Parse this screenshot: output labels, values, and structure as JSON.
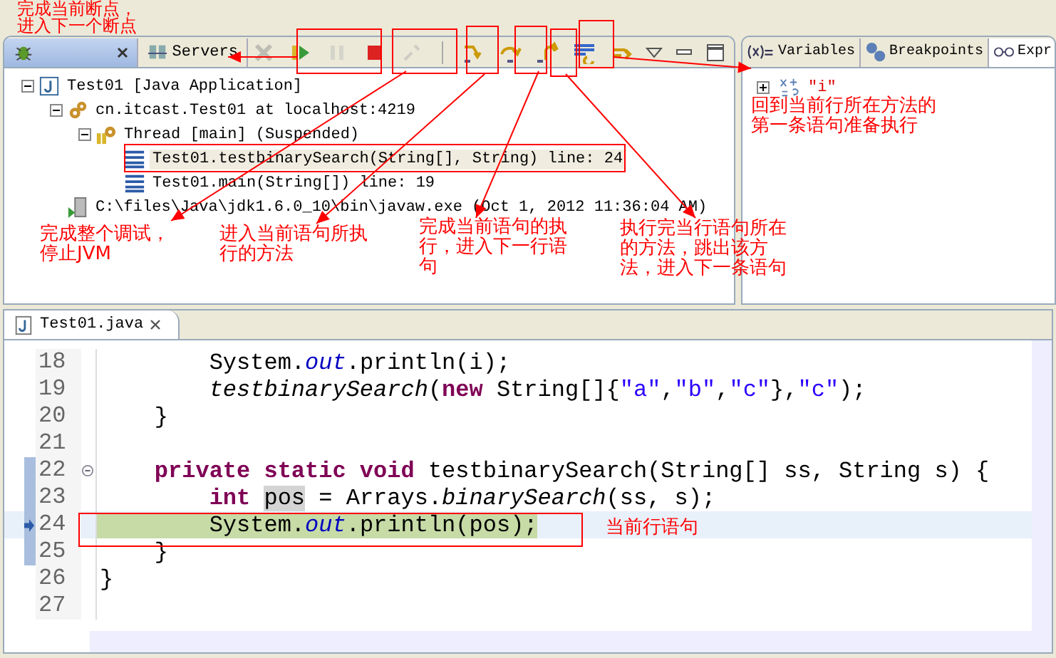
{
  "debug_view": {
    "tabs": [
      {
        "kind": "debug",
        "selected": true
      },
      {
        "kind": "servers",
        "label": "Servers",
        "selected": false
      }
    ],
    "toolbar": [
      {
        "kind": "skip",
        "disabled": true
      },
      {
        "kind": "resume",
        "disabled": false
      },
      {
        "kind": "suspend",
        "disabled": true
      },
      {
        "kind": "terminate",
        "disabled": false
      },
      {
        "kind": "disconnect",
        "disabled": true
      },
      {
        "kind": "step-into",
        "disabled": false
      },
      {
        "kind": "step-over",
        "disabled": false
      },
      {
        "kind": "step-return",
        "disabled": false
      },
      {
        "kind": "drop-to-frame",
        "disabled": false
      },
      {
        "kind": "step-filters",
        "disabled": false
      }
    ],
    "tree": [
      {
        "kind": "launch",
        "label": "Test01 [Java Application]",
        "expanded": true,
        "selected": false,
        "children": [
          {
            "kind": "target",
            "label": "cn.itcast.Test01 at localhost:4219",
            "expanded": true,
            "selected": false,
            "children": [
              {
                "kind": "thread",
                "label": "Thread [main] (Suspended)",
                "expanded": true,
                "selected": false,
                "children": [
                  {
                    "kind": "frame",
                    "label": "Test01.testbinarySearch(String[], String) line: 24",
                    "selected": true
                  },
                  {
                    "kind": "frame",
                    "label": "Test01.main(String[]) line: 19",
                    "selected": false
                  }
                ]
              }
            ]
          },
          {
            "kind": "process",
            "label": "C:\\files\\Java\\jdk1.6.0_10\\bin\\javaw.exe (Oct 1, 2012 11:36:04 AM)",
            "selected": false
          }
        ]
      }
    ]
  },
  "variables_view": {
    "tabs": [
      {
        "kind": "variables",
        "label": "Variables",
        "selected": false
      },
      {
        "kind": "breakpoints",
        "label": "Breakpoints",
        "selected": false
      },
      {
        "kind": "expressions",
        "label": "Expr",
        "selected": true
      }
    ],
    "expressions": [
      {
        "label": "\"i\"",
        "expanded": false
      }
    ]
  },
  "editor": {
    "tab": "Test01.java",
    "lines": [
      {
        "number": "18",
        "tokens": [
          {
            "text": "        System.",
            "kind": "plain"
          },
          {
            "text": "out",
            "kind": "static_field"
          },
          {
            "text": ".println(i);",
            "kind": "plain"
          }
        ]
      },
      {
        "number": "19",
        "tokens": [
          {
            "text": "        testbinarySearch",
            "kind": "static_method"
          },
          {
            "text": "(",
            "kind": "plain"
          },
          {
            "text": "new",
            "kind": "keyword"
          },
          {
            "text": " String[]{",
            "kind": "plain"
          },
          {
            "text": "\"a\"",
            "kind": "string"
          },
          {
            "text": ",",
            "kind": "plain"
          },
          {
            "text": "\"b\"",
            "kind": "string"
          },
          {
            "text": ",",
            "kind": "plain"
          },
          {
            "text": "\"c\"",
            "kind": "string"
          },
          {
            "text": "},",
            "kind": "plain"
          },
          {
            "text": "\"c\"",
            "kind": "string"
          },
          {
            "text": ");",
            "kind": "plain"
          }
        ]
      },
      {
        "number": "20",
        "tokens": [
          {
            "text": "    }",
            "kind": "plain"
          }
        ]
      },
      {
        "number": "21"
      },
      {
        "number": "22",
        "foldable": true,
        "in_range": true,
        "tokens": [
          {
            "text": "    private static void",
            "kind": "keyword"
          },
          {
            "text": " testbinarySearch(String[] ss, String s) {",
            "kind": "plain"
          }
        ]
      },
      {
        "number": "23",
        "in_range": true,
        "tokens": [
          {
            "text": "        int ",
            "kind": "keyword"
          },
          {
            "text": "pos",
            "kind": "occurrence"
          },
          {
            "text": " = Arrays.",
            "kind": "plain"
          },
          {
            "text": "binarySearch",
            "kind": "static_method"
          },
          {
            "text": "(ss, s);",
            "kind": "plain"
          }
        ]
      },
      {
        "number": "24",
        "in_range": true,
        "current": true,
        "tokens": [
          {
            "text": "        System.",
            "kind": "plain"
          },
          {
            "text": "out",
            "kind": "static_field"
          },
          {
            "text": ".println(pos);",
            "kind": "plain"
          }
        ]
      },
      {
        "number": "25",
        "in_range": true,
        "tokens": [
          {
            "text": "    }",
            "kind": "plain"
          }
        ]
      },
      {
        "number": "26",
        "tokens": [
          {
            "text": "}",
            "kind": "plain"
          }
        ]
      },
      {
        "number": "27"
      }
    ]
  },
  "annotations": [
    "完成当前断点，进入下一个断点",
    "完成整个调试，停止JVM",
    "进入当前语句所执行的方法",
    "完成当前语句的执行，进入下一行语句",
    "执行完当行语句所在的方法，跳出该方法，进入下一条语句",
    "回到当前行所在方法的第一条语句准备执行",
    "当前行语句"
  ]
}
